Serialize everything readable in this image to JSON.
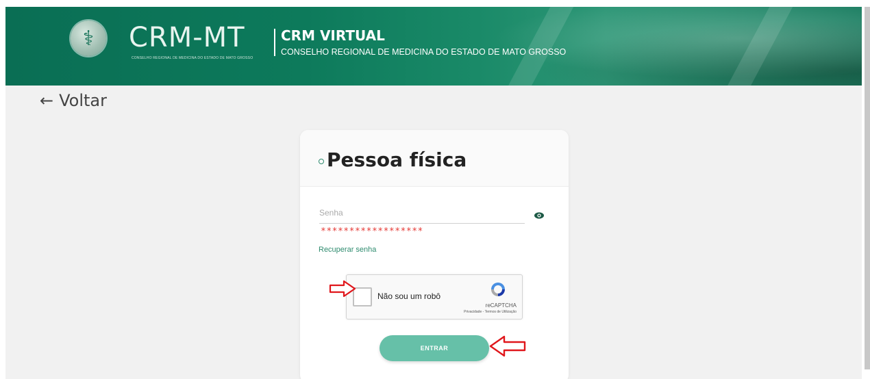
{
  "header": {
    "logo_symbol": "⚕",
    "brand": "CRM-MT",
    "brand_subtitle": "CONSELHO REGIONAL DE MEDICINA DO ESTADO DE MATO GROSSO",
    "title": "CRM VIRTUAL",
    "subtitle": "CONSELHO REGIONAL DE MEDICINA DO ESTADO DE MATO GROSSO"
  },
  "nav": {
    "back_icon": "arrow-left-icon",
    "back_label": "Voltar"
  },
  "card": {
    "title": "Pessoa física",
    "password": {
      "label": "Senha",
      "value_masked": "******************",
      "toggle_icon": "eye-icon"
    },
    "recover_link": "Recuperar senha",
    "recaptcha": {
      "label": "Não sou um robô",
      "brand": "reCAPTCHA",
      "links": "Privacidade - Termos de Utilização"
    },
    "submit_label": "ENTRAR"
  },
  "colors": {
    "header_green": "#0d7a5b",
    "accent_green": "#2e8b6e",
    "button_green": "#66c0a8",
    "error_red": "#e53935",
    "annotation_red": "#e0161b"
  }
}
